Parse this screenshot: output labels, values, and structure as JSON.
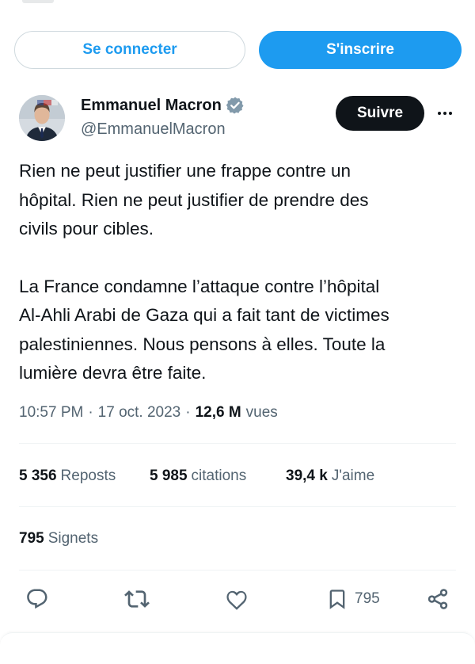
{
  "auth": {
    "login_label": "Se connecter",
    "signup_label": "S'inscrire"
  },
  "author": {
    "name": "Emmanuel Macron",
    "handle": "@EmmanuelMacron",
    "verified": true,
    "verified_color": "#829aab"
  },
  "follow_label": "Suivre",
  "tweet": {
    "paragraphs": [
      "Rien ne peut justifier une frappe contre un\nhôpital. Rien ne peut justifier de prendre des\ncivils pour cibles.",
      "La France condamne l’attaque contre l’hôpital\nAl-Ahli Arabi de Gaza qui a fait tant de victimes\npalestiniennes. Nous pensons à elles. Toute la\nlumière devra être faite."
    ]
  },
  "meta": {
    "time": "10:57 PM",
    "sep1": "·",
    "date": "17 oct. 2023",
    "sep2": "·",
    "views_count": "12,6 M",
    "views_label": "vues"
  },
  "stats": {
    "reposts_count": "5 356",
    "reposts_label": "Reposts",
    "quotes_count": "5 985",
    "quotes_label": "citations",
    "likes_count": "39,4 k",
    "likes_label": "J'aime",
    "bookmarks_count": "795",
    "bookmarks_label": "Signets"
  },
  "actions": {
    "bookmark_count": "795"
  },
  "colors": {
    "accent": "#1d9bf0",
    "text_primary": "#0f1419",
    "text_secondary": "#536471",
    "follow_bg": "#0f1419"
  },
  "icons": [
    "verified-badge-icon",
    "more-icon",
    "reply-icon",
    "repost-icon",
    "like-icon",
    "bookmark-icon",
    "share-icon"
  ]
}
